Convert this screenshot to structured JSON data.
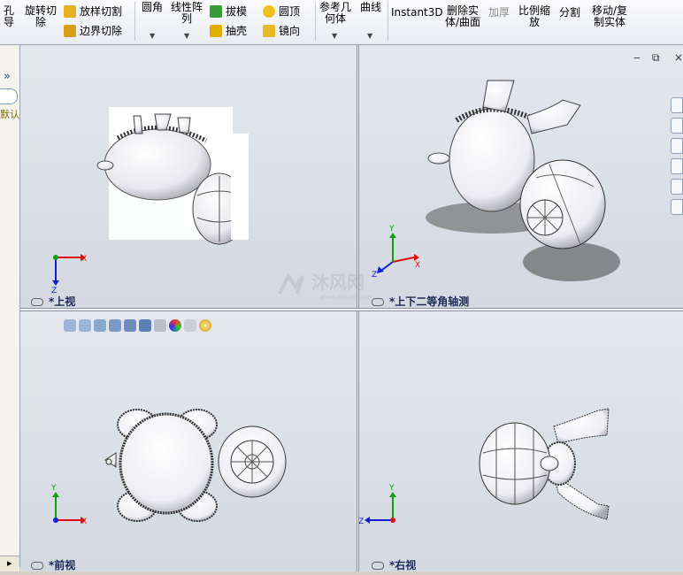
{
  "toolbar": {
    "hole_wizard": "孔\n导",
    "revolve_cut": "旋转切\n除",
    "loft_cut": "放样切割",
    "boundary_cut": "边界切除",
    "fillet": "圆角",
    "linear_pattern": "线性阵\n列",
    "draft": "拔模",
    "dome": "圆顶",
    "shell": "抽壳",
    "mirror": "镜向",
    "ref_geometry": "参考几\n何体",
    "curves": "曲线",
    "instant3d": "Instant3D",
    "delete_body": "删除实\n体/曲面",
    "thicken": "加厚",
    "scale": "比例缩\n放",
    "split": "分割",
    "move_copy": "移动/复\n制实体"
  },
  "left_panel": {
    "text": "默认"
  },
  "views": {
    "top": "*上视",
    "iso": "*上下二等角轴测",
    "front": "*前视",
    "right": "*右视"
  },
  "watermark": "沐风网",
  "watermark_sub": "www.mfcad.com",
  "axes": {
    "x": "X",
    "y": "Y",
    "z": "Z"
  },
  "colors": {
    "x_axis": "#e01010",
    "y_axis": "#10a010",
    "z_axis": "#1020d0"
  }
}
